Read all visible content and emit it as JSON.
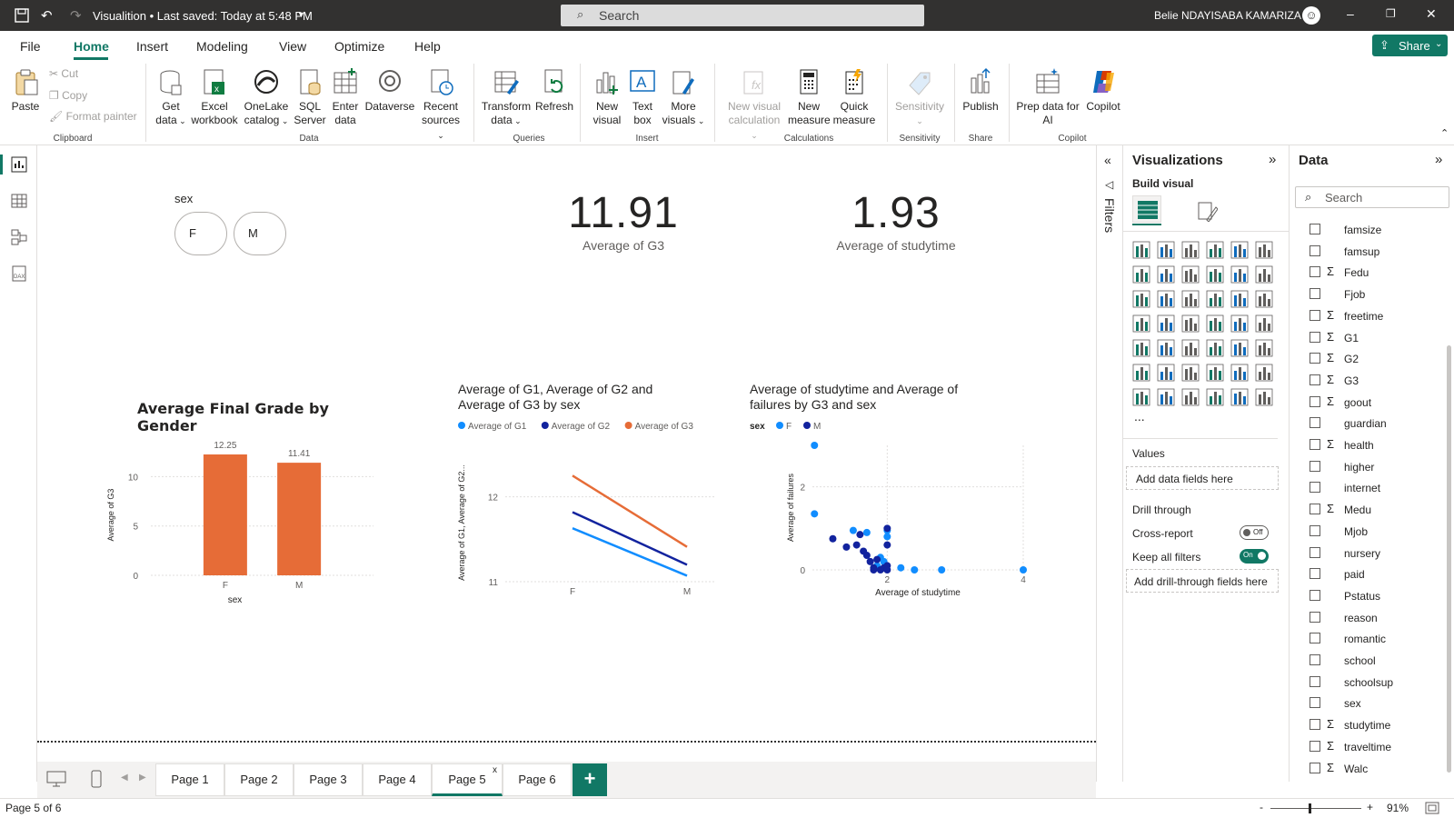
{
  "titlebar": {
    "title": "Visualition • Last saved: Today at 5:48 PM",
    "search_placeholder": "Search",
    "user": "Belie NDAYISABA KAMARIZA"
  },
  "tabs": [
    "File",
    "Home",
    "Insert",
    "Modeling",
    "View",
    "Optimize",
    "Help"
  ],
  "share_label": "Share",
  "ribbon": {
    "clipboard": {
      "paste": "Paste",
      "cut": "Cut",
      "copy": "Copy",
      "format_painter": "Format painter",
      "group": "Clipboard"
    },
    "data": {
      "get_data": [
        "Get",
        "data"
      ],
      "excel": [
        "Excel",
        "workbook"
      ],
      "onelake": [
        "OneLake",
        "catalog"
      ],
      "sql": [
        "SQL",
        "Server"
      ],
      "enter": [
        "Enter",
        "data"
      ],
      "dataverse": "Dataverse",
      "recent": [
        "Recent",
        "sources"
      ],
      "group": "Data"
    },
    "queries": {
      "transform": [
        "Transform",
        "data"
      ],
      "refresh": "Refresh",
      "group": "Queries"
    },
    "insert": {
      "new_visual": [
        "New",
        "visual"
      ],
      "text_box": [
        "Text",
        "box"
      ],
      "more_visuals": [
        "More",
        "visuals"
      ],
      "group": "Insert"
    },
    "calculations": {
      "new_visual_calc": [
        "New visual",
        "calculation"
      ],
      "new_measure": [
        "New",
        "measure"
      ],
      "quick_measure": [
        "Quick",
        "measure"
      ],
      "group": "Calculations"
    },
    "sensitivity": {
      "label": "Sensitivity",
      "group": "Sensitivity"
    },
    "share": {
      "publish": "Publish",
      "group": "Share"
    },
    "copilot": {
      "prep": [
        "Prep data for",
        "AI"
      ],
      "copilot": "Copilot",
      "group": "Copilot"
    }
  },
  "slicer": {
    "title": "sex",
    "options": [
      "F",
      "M"
    ]
  },
  "cards": [
    {
      "value": "11.91",
      "label": "Average of G3"
    },
    {
      "value": "1.93",
      "label": "Average of studytime"
    }
  ],
  "chart_data": [
    {
      "type": "bar",
      "title": "Average Final Grade by Gender",
      "xlabel": "sex",
      "ylabel": "Average of G3",
      "categories": [
        "F",
        "M"
      ],
      "values": [
        12.25,
        11.41
      ],
      "data_labels": [
        "12.25",
        "11.41"
      ],
      "ylim": [
        0,
        12.25
      ],
      "yticks": [
        "0",
        "5",
        "10"
      ],
      "color": "#E66C37"
    },
    {
      "type": "line",
      "title": "Average of G1, Average of G2 and Average of G3 by sex",
      "xlabel": "sex",
      "ylabel": "Average of G1, Average of G2...",
      "categories": [
        "F",
        "M"
      ],
      "yticks": [
        "11",
        "12"
      ],
      "ylim": [
        11,
        12.5
      ],
      "series": [
        {
          "name": "Average of G1",
          "color": "#118DFF",
          "values": [
            11.63,
            11.07
          ]
        },
        {
          "name": "Average of G2",
          "color": "#12239E",
          "values": [
            11.82,
            11.2
          ]
        },
        {
          "name": "Average of G3",
          "color": "#E66C37",
          "values": [
            12.25,
            11.41
          ]
        }
      ]
    },
    {
      "type": "scatter",
      "title": "Average of studytime and Average of failures by G3 and sex",
      "xlabel": "Average of studytime",
      "ylabel": "Average of failures",
      "legend_title": "sex",
      "xlim": [
        0.9,
        4
      ],
      "ylim": [
        0,
        3
      ],
      "xticks": [
        "2",
        "4"
      ],
      "yticks": [
        "0",
        "2"
      ],
      "series": [
        {
          "name": "F",
          "color": "#118DFF",
          "points": [
            [
              0.93,
              3.0
            ],
            [
              0.93,
              1.35
            ],
            [
              1.5,
              0.95
            ],
            [
              1.7,
              0.9
            ],
            [
              1.9,
              0.3
            ],
            [
              2.0,
              0.95
            ],
            [
              2.0,
              0.8
            ],
            [
              2.2,
              0.05
            ],
            [
              2.4,
              0.0
            ],
            [
              2.8,
              0.0
            ],
            [
              4.0,
              0.0
            ],
            [
              1.85,
              0.1
            ],
            [
              1.95,
              0.2
            ]
          ]
        },
        {
          "name": "M",
          "color": "#12239E",
          "points": [
            [
              1.2,
              0.75
            ],
            [
              1.4,
              0.55
            ],
            [
              1.55,
              0.6
            ],
            [
              1.65,
              0.45
            ],
            [
              1.75,
              0.2
            ],
            [
              1.8,
              0.05
            ],
            [
              1.9,
              0.0
            ],
            [
              2.0,
              1.0
            ],
            [
              2.0,
              0.6
            ],
            [
              2.0,
              0.1
            ],
            [
              1.95,
              0.05
            ],
            [
              1.7,
              0.35
            ],
            [
              1.8,
              0.0
            ],
            [
              1.6,
              0.85
            ],
            [
              1.85,
              0.25
            ],
            [
              2.0,
              0.0
            ]
          ]
        }
      ]
    }
  ],
  "filters_label": "Filters",
  "viz": {
    "title": "Visualizations",
    "build_visual": "Build visual",
    "values": "Values",
    "add_data_fields": "Add data fields here",
    "drill_through": "Drill through",
    "cross_report": "Cross-report",
    "cross_report_state": "Off",
    "keep_all_filters": "Keep all filters",
    "keep_state": "On",
    "add_drill": "Add drill-through fields here",
    "more": "..."
  },
  "data_pane": {
    "title": "Data",
    "search_placeholder": "Search",
    "fields": [
      {
        "name": "famsize",
        "sigma": false
      },
      {
        "name": "famsup",
        "sigma": false
      },
      {
        "name": "Fedu",
        "sigma": true
      },
      {
        "name": "Fjob",
        "sigma": false
      },
      {
        "name": "freetime",
        "sigma": true
      },
      {
        "name": "G1",
        "sigma": true
      },
      {
        "name": "G2",
        "sigma": true
      },
      {
        "name": "G3",
        "sigma": true
      },
      {
        "name": "goout",
        "sigma": true
      },
      {
        "name": "guardian",
        "sigma": false
      },
      {
        "name": "health",
        "sigma": true
      },
      {
        "name": "higher",
        "sigma": false
      },
      {
        "name": "internet",
        "sigma": false
      },
      {
        "name": "Medu",
        "sigma": true
      },
      {
        "name": "Mjob",
        "sigma": false
      },
      {
        "name": "nursery",
        "sigma": false
      },
      {
        "name": "paid",
        "sigma": false
      },
      {
        "name": "Pstatus",
        "sigma": false
      },
      {
        "name": "reason",
        "sigma": false
      },
      {
        "name": "romantic",
        "sigma": false
      },
      {
        "name": "school",
        "sigma": false
      },
      {
        "name": "schoolsup",
        "sigma": false
      },
      {
        "name": "sex",
        "sigma": false
      },
      {
        "name": "studytime",
        "sigma": true
      },
      {
        "name": "traveltime",
        "sigma": true
      },
      {
        "name": "Walc",
        "sigma": true
      }
    ]
  },
  "pages": [
    "Page 1",
    "Page 2",
    "Page 3",
    "Page 4",
    "Page 5",
    "Page 6"
  ],
  "active_page": "Page 5",
  "status": {
    "page_info": "Page 5 of 6",
    "zoom": "91%"
  },
  "colors": {
    "accent": "#117865",
    "orange": "#E66C37",
    "blue": "#118DFF",
    "navy": "#12239E"
  }
}
